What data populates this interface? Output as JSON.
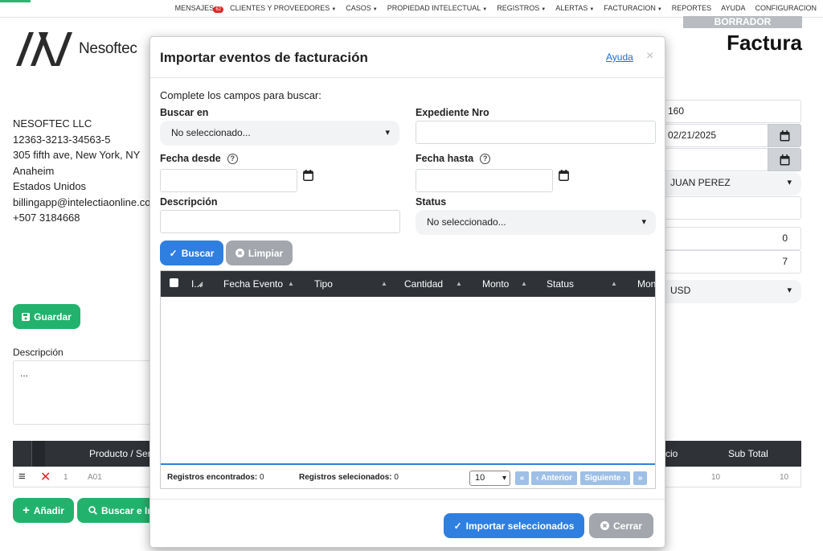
{
  "nav": {
    "items": [
      {
        "label": "MENSAJES",
        "caret": false,
        "badge": "62"
      },
      {
        "label": "CLIENTES Y PROVEEDORES",
        "caret": true
      },
      {
        "label": "CASOS",
        "caret": true
      },
      {
        "label": "PROPIEDAD INTELECTUAL",
        "caret": true
      },
      {
        "label": "REGISTROS",
        "caret": true
      },
      {
        "label": "ALERTAS",
        "caret": true
      },
      {
        "label": "FACTURACION",
        "caret": true
      },
      {
        "label": "REPORTES",
        "caret": false
      },
      {
        "label": "AYUDA",
        "caret": false
      },
      {
        "label": "CONFIGURACION",
        "caret": false
      }
    ]
  },
  "brand": {
    "name": "Nesoftec"
  },
  "company": {
    "name": "NESOFTEC LLC",
    "id": "12363-3213-34563-5",
    "address": "305 fifth ave, New York, NY",
    "city": "Anaheim",
    "country": "Estados Unidos",
    "email": "billingapp@intelectiaonline.com",
    "phone": "+507 3184668"
  },
  "invoice": {
    "status": "BORRADOR",
    "title": "Factura",
    "number": "160",
    "date": "02/21/2025",
    "due_date": "",
    "client": "JUAN PEREZ",
    "field5": "",
    "field6": "0",
    "field7": "7",
    "currency": "USD"
  },
  "page": {
    "save_label": "Guardar",
    "description_label": "Descripción",
    "description_value": "...",
    "add_label": "Añadir",
    "search_import_label": "Buscar e Im",
    "table_headers": {
      "product": "Producto / Ser",
      "price": "cio",
      "subtotal": "Sub Total"
    },
    "row": {
      "num": "1",
      "code": "A01",
      "price": "10",
      "subtotal": "10"
    }
  },
  "modal": {
    "title": "Importar eventos de facturación",
    "help_label": "Ayuda",
    "close_symbol": "×",
    "instructions": "Complete los campos para buscar:",
    "search_in_label": "Buscar en",
    "search_in_value": "No seleccionado...",
    "expediente_label": "Expediente Nro",
    "date_from_label": "Fecha desde",
    "date_to_label": "Fecha hasta",
    "description_label": "Descripción",
    "status_label": "Status",
    "status_value": "No seleccionado...",
    "search_button": "Buscar",
    "clear_button": "Limpiar",
    "columns": [
      "I...",
      "Fecha Evento",
      "Tipo",
      "Cantidad",
      "Monto",
      "Status",
      "Mon"
    ],
    "records_found_label": "Registros encontrados:",
    "records_found_value": "0",
    "records_selected_label": "Registros selecionados:",
    "records_selected_value": "0",
    "page_size": "10",
    "prev_label": "Anterior",
    "next_label": "Siguiente",
    "import_button": "Importar seleccionados",
    "close_button": "Cerrar"
  },
  "colors": {
    "green": "#23b26d",
    "blue": "#2f7fe0",
    "dark_header": "#2f3237",
    "badge": "#e02424"
  }
}
